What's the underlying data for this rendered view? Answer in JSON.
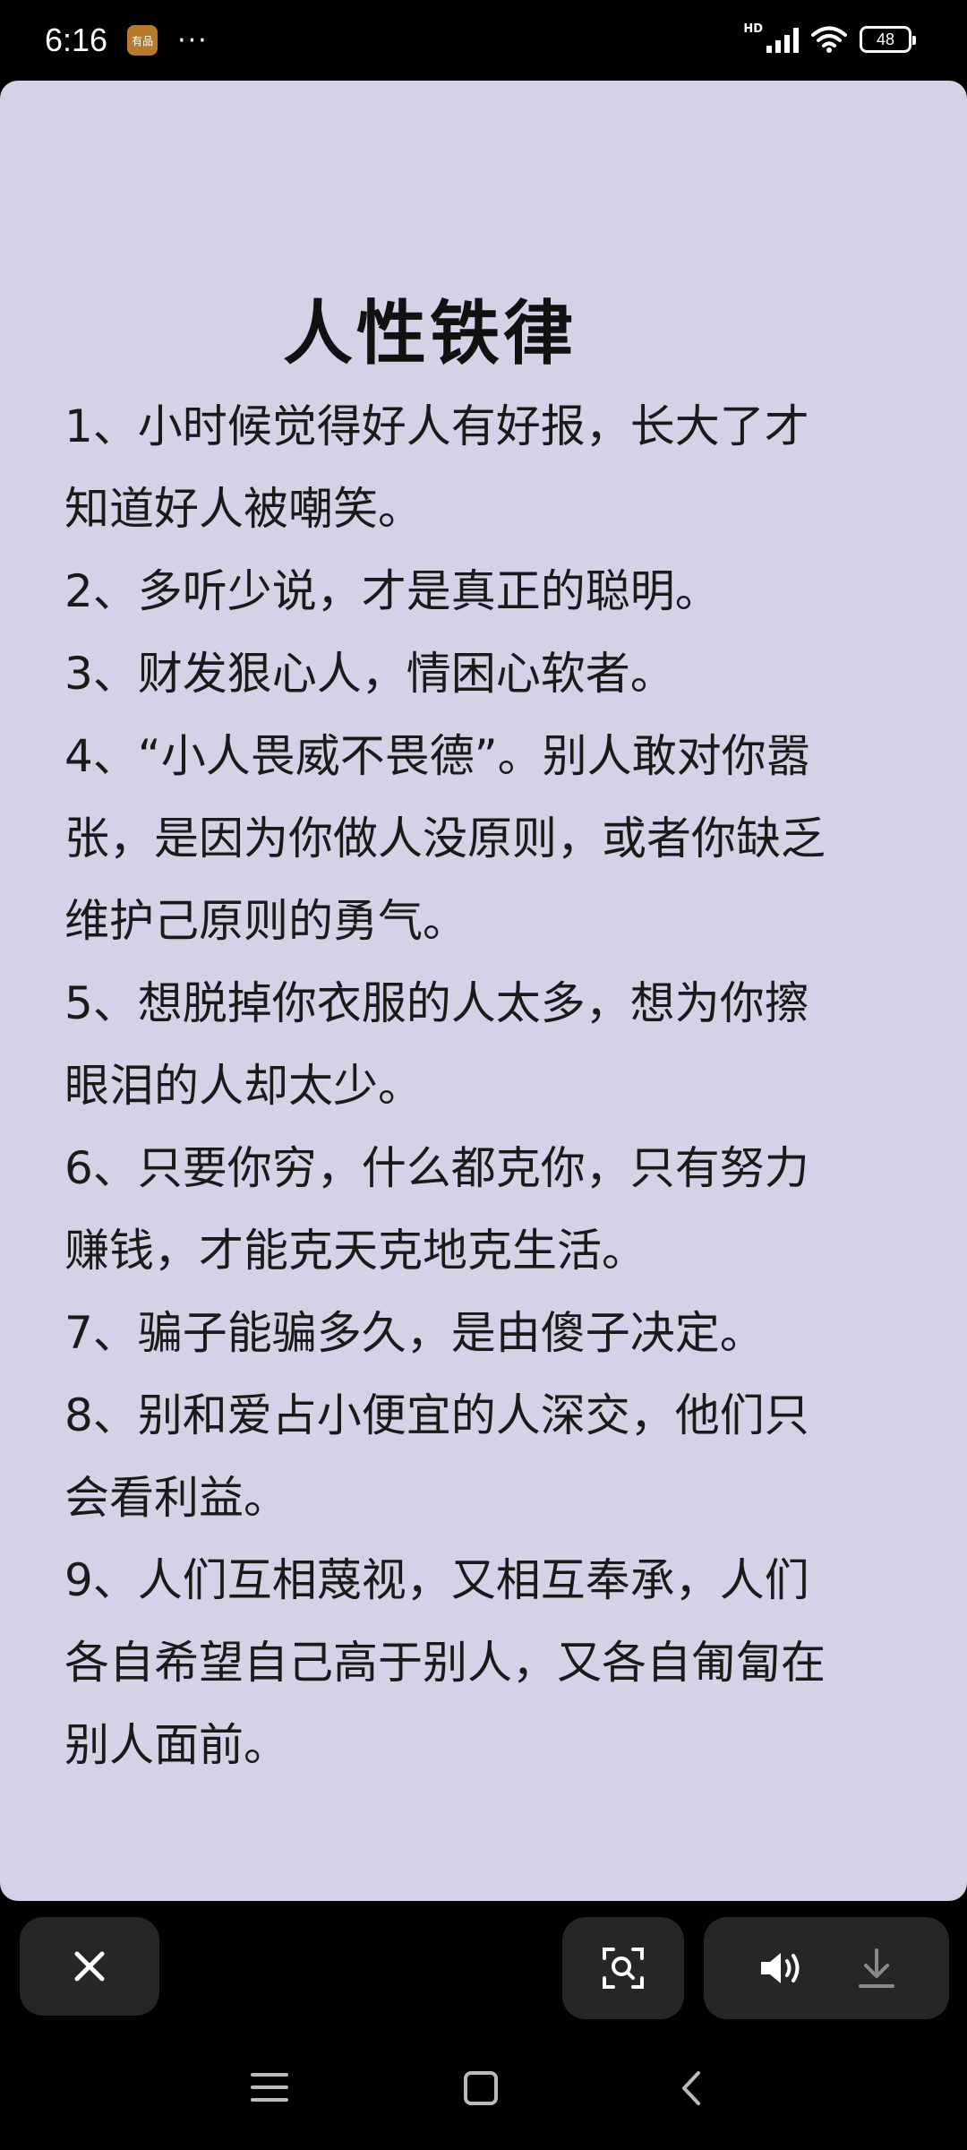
{
  "status_bar": {
    "time": "6:16",
    "app_badge": "有品",
    "more_dots": "···",
    "hd_label": "HD",
    "battery_level": "48"
  },
  "article": {
    "title": "人性铁律",
    "lines": [
      "1、小时候觉得好人有好报，长大了才",
      "知道好人被嘲笑。",
      "2、多听少说，才是真正的聪明。",
      "3、财发狠心人，情困心软者。",
      "4、“小人畏威不畏德”。别人敢对你嚣",
      "张，是因为你做人没原则，或者你缺乏",
      "维护己原则的勇气。",
      "5、想脱掉你衣服的人太多，想为你擦",
      "眼泪的人却太少。",
      "6、只要你穷，什么都克你，只有努力",
      "赚钱，才能克天克地克生活。",
      "7、骗子能骗多久，是由傻子决定。",
      "8、别和爱占小便宜的人深交，他们只",
      "会看利益。",
      "9、人们互相蔑视，又相互奉承，人们",
      "各自希望自己高于别人，又各自匍匐在",
      "别人面前。"
    ]
  },
  "icons": {
    "close": "close-icon",
    "scan": "image-search-icon",
    "speaker": "speaker-icon",
    "download": "download-icon",
    "menu": "menu-icon",
    "home": "home-icon",
    "back": "back-icon"
  }
}
